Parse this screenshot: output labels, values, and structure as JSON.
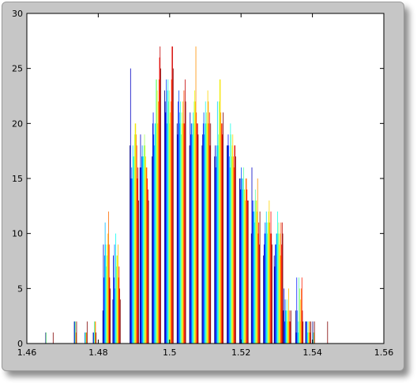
{
  "chart_data": {
    "type": "bar",
    "title": "",
    "xlabel": "",
    "ylabel": "",
    "xlim": [
      1.46,
      1.56
    ],
    "ylim": [
      0,
      30
    ],
    "xticks": [
      "1.46",
      "1.48",
      "1.5",
      "1.52",
      "1.54",
      "1.56"
    ],
    "xtick_values": [
      1.46,
      1.48,
      1.5,
      1.52,
      1.54,
      1.56
    ],
    "yticks": [
      "0",
      "5",
      "10",
      "15",
      "20",
      "25",
      "30"
    ],
    "ytick_values": [
      0,
      5,
      10,
      15,
      20,
      25,
      30
    ],
    "grid": false,
    "legend": "none",
    "colormap": "jet",
    "background_color": "#c6c6c6",
    "axes_color": "#ffffff",
    "bin_width": 0.00016,
    "bins": [
      {
        "x": 1.4652,
        "values": [
          1,
          1,
          0
        ]
      },
      {
        "x": 1.4668,
        "values": [
          0,
          0,
          0,
          1
        ]
      },
      {
        "x": 1.4732,
        "values": [
          2,
          2,
          2,
          1,
          2
        ]
      },
      {
        "x": 1.476,
        "values": [
          0,
          1,
          1,
          1,
          1,
          2
        ]
      },
      {
        "x": 1.4785,
        "values": [
          1,
          1,
          2,
          2,
          2,
          1
        ]
      },
      {
        "x": 1.4812,
        "values": [
          3,
          9,
          6,
          8,
          11,
          9,
          7,
          8,
          9,
          10,
          12,
          9,
          6,
          5
        ]
      },
      {
        "x": 1.484,
        "values": [
          4,
          8,
          6,
          9,
          5,
          10,
          7,
          8,
          8,
          9,
          6,
          7,
          5,
          4
        ]
      },
      {
        "x": 1.4888,
        "values": [
          18,
          25,
          15,
          16,
          15,
          18,
          17,
          17,
          19,
          20,
          20,
          19,
          18,
          15,
          16,
          13
        ]
      },
      {
        "x": 1.4916,
        "values": [
          16,
          19,
          16,
          17,
          18,
          17,
          17,
          18,
          19,
          18,
          17,
          16,
          16,
          15,
          14,
          13
        ]
      },
      {
        "x": 1.495,
        "values": [
          17,
          20,
          21,
          19,
          18,
          20,
          20,
          24,
          24,
          23,
          20,
          22,
          24,
          26,
          27,
          25
        ]
      },
      {
        "x": 1.4985,
        "values": [
          23,
          22,
          21,
          24,
          20,
          23,
          24,
          22,
          23,
          20,
          21,
          22,
          24,
          27,
          27,
          25
        ]
      },
      {
        "x": 1.502,
        "values": [
          20,
          19,
          22,
          23,
          21,
          20,
          22,
          19,
          21,
          20,
          22,
          20,
          23,
          20,
          24,
          22
        ]
      },
      {
        "x": 1.5055,
        "values": [
          18,
          21,
          19,
          20,
          20,
          19,
          21,
          20,
          22,
          23,
          22,
          27,
          21,
          20,
          20,
          19
        ]
      },
      {
        "x": 1.509,
        "values": [
          18,
          19,
          20,
          21,
          19,
          20,
          22,
          20,
          21,
          20,
          23,
          22,
          20,
          21,
          18,
          20
        ]
      },
      {
        "x": 1.5125,
        "values": [
          17,
          18,
          16,
          17,
          18,
          22,
          18,
          19,
          22,
          24,
          24,
          21,
          20,
          20,
          19,
          21
        ]
      },
      {
        "x": 1.516,
        "values": [
          18,
          18,
          19,
          18,
          17,
          16,
          20,
          19,
          17,
          18,
          19,
          17,
          16,
          18,
          18,
          17
        ]
      },
      {
        "x": 1.5195,
        "values": [
          15,
          15,
          14,
          16,
          15,
          14,
          15,
          16,
          14,
          14,
          13,
          15,
          15,
          14,
          13,
          13
        ]
      },
      {
        "x": 1.5228,
        "values": [
          10,
          16,
          13,
          12,
          13,
          12,
          11,
          14,
          13,
          13,
          12,
          15,
          10,
          11,
          9,
          12
        ]
      },
      {
        "x": 1.5262,
        "values": [
          8,
          9,
          10,
          11,
          10,
          12,
          11,
          10,
          11,
          12,
          13,
          11,
          10,
          12,
          10,
          9
        ]
      },
      {
        "x": 1.5292,
        "values": [
          8,
          7,
          9,
          9,
          10,
          10,
          12,
          10,
          11,
          9,
          10,
          8,
          11,
          9,
          11,
          10
        ]
      },
      {
        "x": 1.5318,
        "values": [
          3,
          5,
          2,
          4,
          3,
          3,
          4,
          2,
          3,
          5,
          2,
          3,
          2,
          3
        ]
      },
      {
        "x": 1.5352,
        "values": [
          3,
          1,
          6,
          3,
          1,
          2,
          6,
          5,
          2,
          4,
          5,
          6,
          3,
          2
        ]
      },
      {
        "x": 1.538,
        "values": [
          2,
          2,
          2,
          1,
          2,
          1,
          2,
          2,
          1,
          2
        ]
      },
      {
        "x": 1.54,
        "values": [
          2,
          1,
          1,
          2
        ]
      },
      {
        "x": 1.544,
        "values": [
          0,
          2
        ]
      }
    ]
  }
}
